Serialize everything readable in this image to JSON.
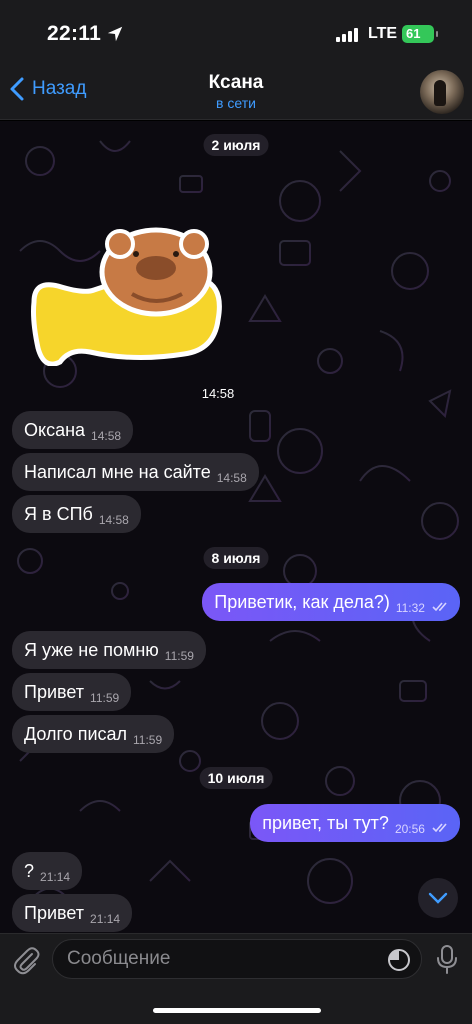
{
  "status_bar": {
    "time": "22:11",
    "network": "LTE",
    "battery": "61",
    "icons": [
      "location-arrow-icon",
      "signal-bars-icon",
      "battery-icon"
    ]
  },
  "header": {
    "back_label": "Назад",
    "contact_name": "Ксана",
    "contact_status": "в сети"
  },
  "chat": {
    "sticker": "bear-on-yellow-fish-sticker",
    "sticker_time": "14:58",
    "dates": [
      "2 июля",
      "8 июля",
      "10 июля"
    ],
    "messages": [
      {
        "dir": "in",
        "text": "Оксана",
        "time": "14:58"
      },
      {
        "dir": "in",
        "text": "Написал мне на сайте",
        "time": "14:58"
      },
      {
        "dir": "in",
        "text": "Я в СПб",
        "time": "14:58"
      },
      {
        "dir": "out",
        "text": "Приветик, как дела?)",
        "time": "11:32"
      },
      {
        "dir": "in",
        "text": "Я уже не помню",
        "time": "11:59"
      },
      {
        "dir": "in",
        "text": "Привет",
        "time": "11:59"
      },
      {
        "dir": "in",
        "text": "Долго писал",
        "time": "11:59"
      },
      {
        "dir": "out",
        "text": "привет, ты тут?",
        "time": "20:56"
      },
      {
        "dir": "in",
        "text": "?",
        "time": "21:14"
      },
      {
        "dir": "in",
        "text": "Привет",
        "time": "21:14"
      }
    ]
  },
  "input": {
    "placeholder": "Сообщение"
  },
  "colors": {
    "accent": "#3f9cff",
    "outgoing_bubble": "#6a5ef7",
    "incoming_bubble": "#2b2930",
    "battery": "#34c759"
  }
}
